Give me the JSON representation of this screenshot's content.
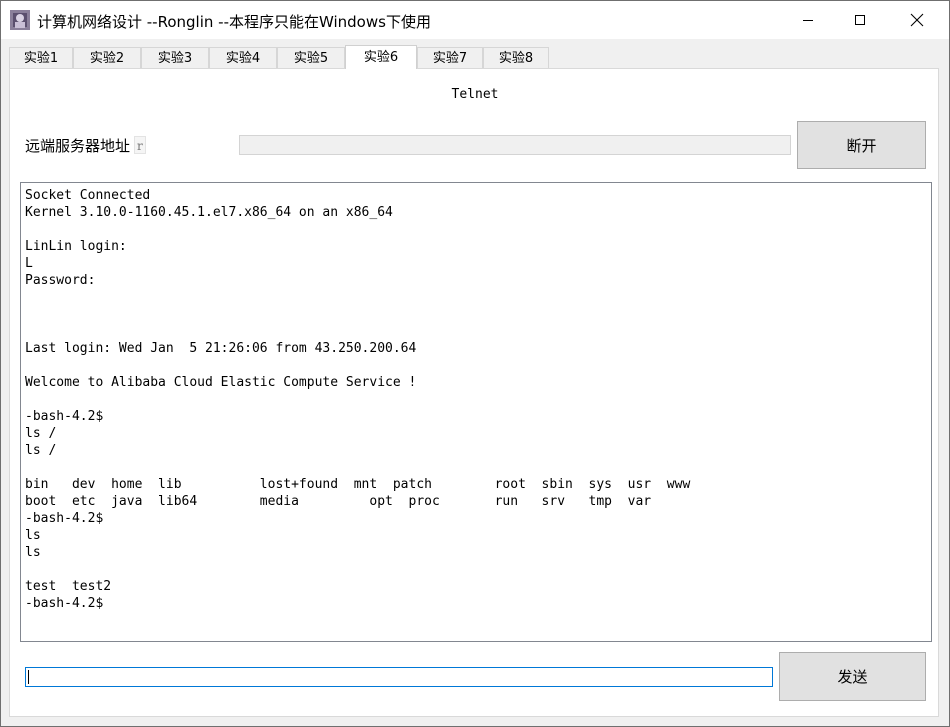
{
  "window": {
    "title": "计算机网络设计 --Ronglin  --本程序只能在Windows下使用"
  },
  "tabs": [
    {
      "label": "实验1"
    },
    {
      "label": "实验2"
    },
    {
      "label": "实验3"
    },
    {
      "label": "实验4"
    },
    {
      "label": "实验5"
    },
    {
      "label": "实验6",
      "active": true
    },
    {
      "label": "实验7"
    },
    {
      "label": "实验8"
    }
  ],
  "panel": {
    "heading": "Telnet",
    "server_address_label": "远端服务器地址",
    "server_address_value": "r",
    "disconnect_label": "断开",
    "send_label": "发送",
    "send_input_value": ""
  },
  "terminal": {
    "output": "Socket Connected\nKernel 3.10.0-1160.45.1.el7.x86_64 on an x86_64\n\nLinLin login:\nL\nPassword:\n\n\n\nLast login: Wed Jan  5 21:26:06 from 43.250.200.64\n\nWelcome to Alibaba Cloud Elastic Compute Service !\n\n-bash-4.2$\nls /\nls /\n\nbin   dev  home  lib          lost+found  mnt  patch        root  sbin  sys  usr  www\nboot  etc  java  lib64        media         opt  proc       run   srv   tmp  var\n-bash-4.2$\nls\nls\n\ntest  test2\n-bash-4.2$"
  },
  "icons": {
    "app": "app-icon",
    "minimize": "minimize-icon",
    "maximize": "maximize-icon",
    "close": "close-icon"
  }
}
